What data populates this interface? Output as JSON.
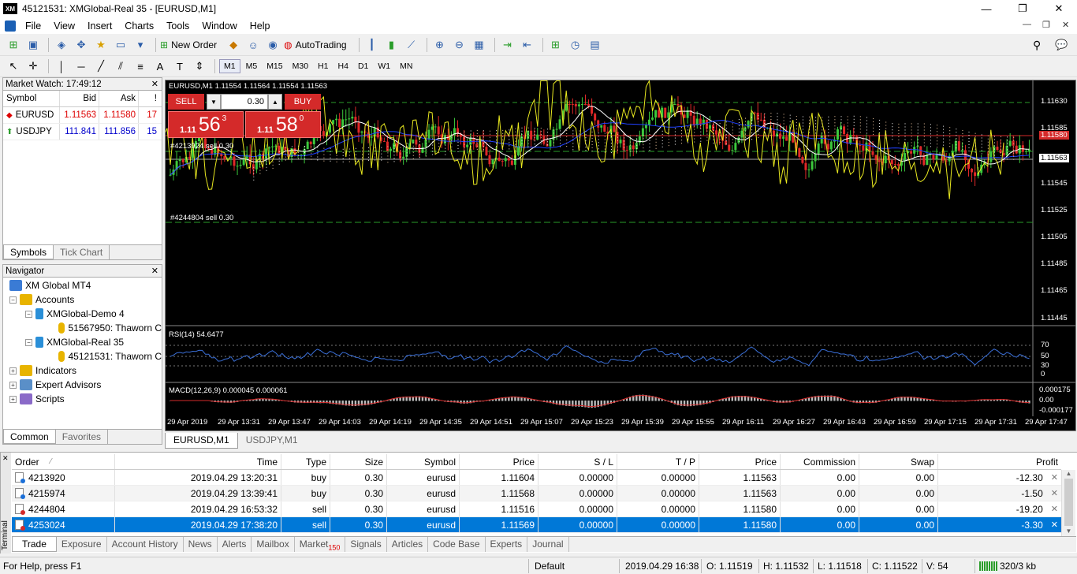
{
  "window": {
    "title": "45121531: XMGlobal-Real 35 - [EURUSD,M1]",
    "logo": "XM",
    "minimize": "—",
    "restore": "❐",
    "close": "✕"
  },
  "menu": [
    "File",
    "View",
    "Insert",
    "Charts",
    "Tools",
    "Window",
    "Help"
  ],
  "toolbar": {
    "new_order": "New Order",
    "autotrading": "AutoTrading"
  },
  "timeframes": [
    "M1",
    "M5",
    "M15",
    "M30",
    "H1",
    "H4",
    "D1",
    "W1",
    "MN"
  ],
  "market_watch": {
    "title": "Market Watch: 17:49:12",
    "headers": {
      "symbol": "Symbol",
      "bid": "Bid",
      "ask": "Ask",
      "spread": "!"
    },
    "rows": [
      {
        "symbol": "EURUSD",
        "bid": "1.11563",
        "ask": "1.11580",
        "spread": "17",
        "dir": "down"
      },
      {
        "symbol": "USDJPY",
        "bid": "111.841",
        "ask": "111.856",
        "spread": "15",
        "dir": "up"
      }
    ],
    "tabs": [
      "Symbols",
      "Tick Chart"
    ]
  },
  "navigator": {
    "title": "Navigator",
    "items": [
      {
        "label": "XM Global MT4",
        "level": 0
      },
      {
        "label": "Accounts",
        "level": 1
      },
      {
        "label": "XMGlobal-Demo 4",
        "level": 2
      },
      {
        "label": "51567950: Thaworn C",
        "level": 3
      },
      {
        "label": "XMGlobal-Real 35",
        "level": 2
      },
      {
        "label": "45121531: Thaworn C",
        "level": 3
      },
      {
        "label": "Indicators",
        "level": 1
      },
      {
        "label": "Expert Advisors",
        "level": 1
      },
      {
        "label": "Scripts",
        "level": 1
      }
    ],
    "tabs": [
      "Common",
      "Favorites"
    ]
  },
  "chart": {
    "header": "EURUSD,M1  1.11554 1.11564 1.11554 1.11563",
    "one_click": {
      "sell": "SELL",
      "buy": "BUY",
      "lot": "0.30",
      "sell_big": "56",
      "sell_prefix": "1.11",
      "sell_sup": "3",
      "buy_big": "58",
      "buy_prefix": "1.11",
      "buy_sup": "0"
    },
    "order_labels": [
      "#4213924 sell 0.30",
      "#4244804 sell 0.30"
    ],
    "price_ticks": [
      "1.11630",
      "1.11585",
      "1.11563",
      "1.11545",
      "1.11525",
      "1.11505",
      "1.11485",
      "1.11465",
      "1.11445"
    ],
    "bid_label": "1.11563",
    "ask_label": "1.11580",
    "rsi_label": "RSI(14) 54.6477",
    "rsi_ticks": [
      "70",
      "50",
      "30",
      "0"
    ],
    "macd_label": "MACD(12,26,9) 0.000045 0.000061",
    "macd_ticks": [
      "0.000175",
      "0.00",
      "-0.000177"
    ],
    "time_ticks": [
      "29 Apr 2019",
      "29 Apr 13:31",
      "29 Apr 13:47",
      "29 Apr 14:03",
      "29 Apr 14:19",
      "29 Apr 14:35",
      "29 Apr 14:51",
      "29 Apr 15:07",
      "29 Apr 15:23",
      "29 Apr 15:39",
      "29 Apr 15:55",
      "29 Apr 16:11",
      "29 Apr 16:27",
      "29 Apr 16:43",
      "29 Apr 16:59",
      "29 Apr 17:15",
      "29 Apr 17:31",
      "29 Apr 17:47"
    ],
    "tabs": [
      "EURUSD,M1",
      "USDJPY,M1"
    ]
  },
  "terminal": {
    "side_label": "Terminal",
    "headers": [
      "Order",
      "Time",
      "Type",
      "Size",
      "Symbol",
      "Price",
      "S / L",
      "T / P",
      "Price",
      "Commission",
      "Swap",
      "Profit"
    ],
    "rows": [
      {
        "order": "4213920",
        "time": "2019.04.29 13:20:31",
        "type": "buy",
        "size": "0.30",
        "symbol": "eurusd",
        "price": "1.11604",
        "sl": "0.00000",
        "tp": "0.00000",
        "cur": "1.11563",
        "comm": "0.00",
        "swap": "0.00",
        "profit": "-12.30"
      },
      {
        "order": "4215974",
        "time": "2019.04.29 13:39:41",
        "type": "buy",
        "size": "0.30",
        "symbol": "eurusd",
        "price": "1.11568",
        "sl": "0.00000",
        "tp": "0.00000",
        "cur": "1.11563",
        "comm": "0.00",
        "swap": "0.00",
        "profit": "-1.50"
      },
      {
        "order": "4244804",
        "time": "2019.04.29 16:53:32",
        "type": "sell",
        "size": "0.30",
        "symbol": "eurusd",
        "price": "1.11516",
        "sl": "0.00000",
        "tp": "0.00000",
        "cur": "1.11580",
        "comm": "0.00",
        "swap": "0.00",
        "profit": "-19.20"
      },
      {
        "order": "4253024",
        "time": "2019.04.29 17:38:20",
        "type": "sell",
        "size": "0.30",
        "symbol": "eurusd",
        "price": "1.11569",
        "sl": "0.00000",
        "tp": "0.00000",
        "cur": "1.11580",
        "comm": "0.00",
        "swap": "0.00",
        "profit": "-3.30"
      }
    ],
    "tabs": [
      "Trade",
      "Exposure",
      "Account History",
      "News",
      "Alerts",
      "Mailbox",
      "Market",
      "Signals",
      "Articles",
      "Code Base",
      "Experts",
      "Journal"
    ],
    "market_badge": "150"
  },
  "status": {
    "help": "For Help, press F1",
    "profile": "Default",
    "datetime": "2019.04.29 16:38",
    "open": "O: 1.11519",
    "high": "H: 1.11532",
    "low": "L: 1.11518",
    "close": "C: 1.11522",
    "volume": "V: 54",
    "traffic": "320/3 kb"
  }
}
